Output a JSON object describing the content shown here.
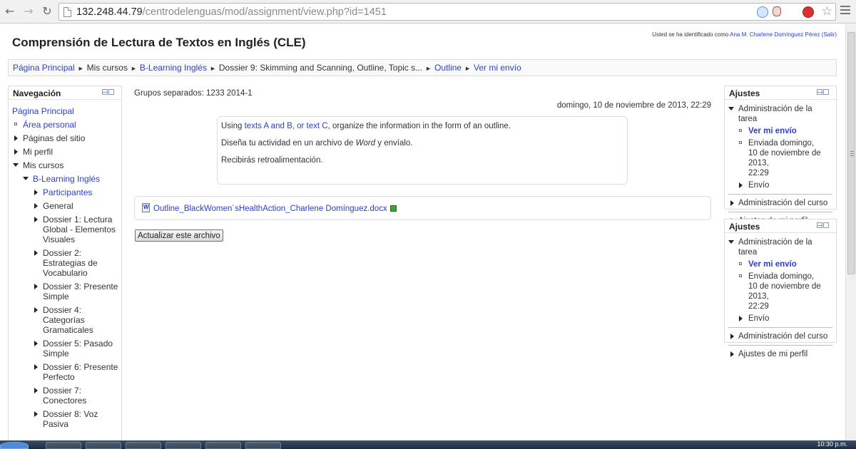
{
  "browser": {
    "url_host": "132.248.44.79",
    "url_path": "/centrodelenguas/mod/assignment/view.php?id=1451"
  },
  "header": {
    "site_title": "Comprensión de Lectura de Textos en Inglés (CLE)",
    "login_prefix": "Usted se ha identificado como",
    "login_user": "Ana M. Charlene Domínguez Pérez",
    "logout": "(Salir)"
  },
  "breadcrumb": [
    {
      "label": "Página Principal",
      "link": true
    },
    {
      "label": "Mis cursos",
      "link": false
    },
    {
      "label": "B-Learning Inglés",
      "link": true
    },
    {
      "label": "Dossier 9: Skimming and Scanning, Outline, Topic s...",
      "link": false
    },
    {
      "label": "Outline",
      "link": true
    },
    {
      "label": "Ver mi envío",
      "link": true
    }
  ],
  "navigation": {
    "title": "Navegación",
    "home": "Página Principal",
    "personal": "Área personal",
    "site_pages": "Páginas del sitio",
    "profile": "Mi perfil",
    "my_courses": "Mis cursos",
    "course": "B-Learning Inglés",
    "participants": "Participantes",
    "general": "General",
    "dossiers": [
      "Dossier 1: Lectura Global - Elementos Visuales",
      "Dossier 2: Estrategias de Vocabulario",
      "Dossier 3: Presente Simple",
      "Dossier 4: Categorías Gramaticales",
      "Dossier 5: Pasado Simple",
      "Dossier 6: Presente Perfecto",
      "Dossier 7: Conectores",
      "Dossier 8: Voz Pasiva"
    ]
  },
  "main": {
    "groups": "Grupos separados: 1233 2014-1",
    "date": "domingo, 10 de noviembre de 2013, 22:29",
    "intro_line1_pre": "Using ",
    "intro_line1_link": "texts A and B, or text C",
    "intro_line1_post": ", organize the information in the form of an outline.",
    "intro_line2_pre": "Diseña tu actividad en un archivo de ",
    "intro_line2_em": "Word",
    "intro_line2_post": " y envíalo.",
    "intro_line3": "Recibirás retroalimentación.",
    "file_name": "Outline_BlackWomen´sHealthAction_Charlene Domínguez.docx",
    "update_button": "Actualizar este archivo"
  },
  "settings": {
    "title": "Ajustes",
    "task_admin": "Administración de la tarea",
    "view_submission": "Ver mi envío",
    "sent_line1": "Enviada domingo,",
    "sent_line2": "10 de noviembre de 2013,",
    "sent_line3": "22:29",
    "submission": "Envío",
    "course_admin": "Administración del curso",
    "profile_settings": "Ajustes de mi perfil"
  },
  "taskbar": {
    "clock": "10:30 p.m."
  }
}
